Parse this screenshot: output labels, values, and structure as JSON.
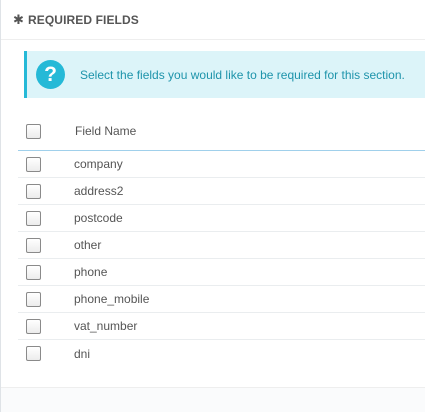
{
  "panel": {
    "heading_icon": "✱",
    "title": "REQUIRED FIELDS"
  },
  "alert": {
    "icon": "question-icon",
    "icon_glyph": "?",
    "text": "Select the fields you would like to be required for this section."
  },
  "table": {
    "column_header": "Field Name",
    "rows": [
      {
        "label": "company",
        "checked": false
      },
      {
        "label": "address2",
        "checked": false
      },
      {
        "label": "postcode",
        "checked": false
      },
      {
        "label": "other",
        "checked": false
      },
      {
        "label": "phone",
        "checked": false
      },
      {
        "label": "phone_mobile",
        "checked": false
      },
      {
        "label": "vat_number",
        "checked": false
      },
      {
        "label": "dni",
        "checked": false
      }
    ]
  },
  "colors": {
    "alert_background": "#dcf4f9",
    "alert_accent": "#25b9d7",
    "alert_text": "#1e94ab",
    "header_border": "#a0d0eb"
  }
}
